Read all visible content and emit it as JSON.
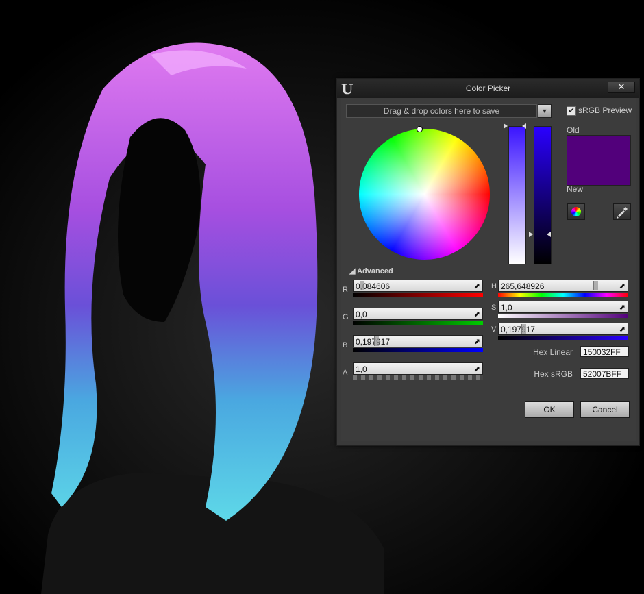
{
  "window": {
    "title": "Color Picker",
    "close_symbol": "✕",
    "logo": "U",
    "logo_icon": "unreal-engine-logo-icon"
  },
  "palette": {
    "dropzone_text": "Drag & drop colors here to save",
    "srgb_preview_label": "sRGB Preview",
    "srgb_preview_checked": true
  },
  "preview": {
    "old_label": "Old",
    "new_label": "New",
    "old_color": "#52007B",
    "new_color": "#52007B"
  },
  "advanced": {
    "label": "Advanced",
    "r": {
      "label": "R",
      "value": "0,084606"
    },
    "g": {
      "label": "G",
      "value": "0,0"
    },
    "b": {
      "label": "B",
      "value": "0,197917"
    },
    "a": {
      "label": "A",
      "value": "1,0"
    },
    "h": {
      "label": "H",
      "value": "265,648926"
    },
    "s": {
      "label": "S",
      "value": "1,0"
    },
    "v": {
      "label": "V",
      "value": "0,197917"
    }
  },
  "hex": {
    "linear_label": "Hex Linear",
    "linear_value": "150032FF",
    "srgb_label": "Hex sRGB",
    "srgb_value": "52007BFF"
  },
  "buttons": {
    "ok": "OK",
    "cancel": "Cancel"
  }
}
